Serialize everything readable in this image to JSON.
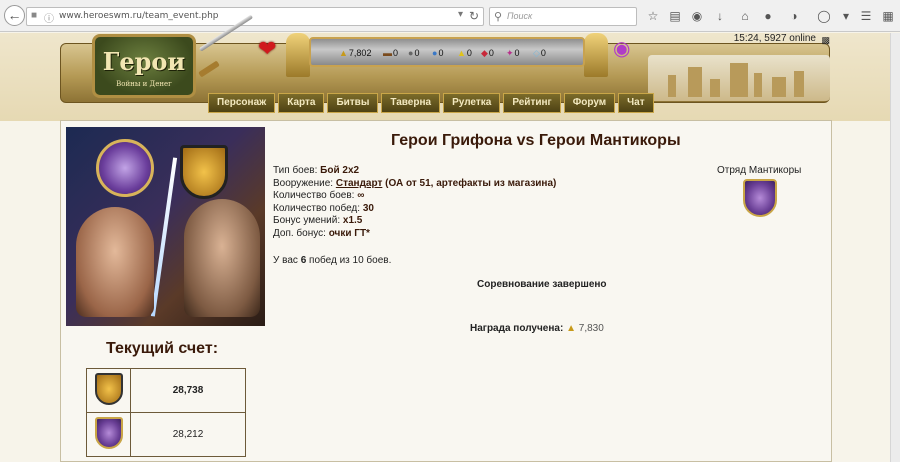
{
  "browser": {
    "url": "www.heroeswm.ru/team_event.php",
    "search_placeholder": "Поиск"
  },
  "header": {
    "logo_main": "Герои",
    "logo_sub": "Войны и Денег",
    "resources": [
      {
        "icon": "gold-icon",
        "value": "7,802"
      },
      {
        "icon": "wood-icon",
        "value": "0"
      },
      {
        "icon": "ore-icon",
        "value": "0"
      },
      {
        "icon": "mercury-icon",
        "value": "0"
      },
      {
        "icon": "sulfur-icon",
        "value": "0"
      },
      {
        "icon": "crystal-icon",
        "value": "0"
      },
      {
        "icon": "gems-icon",
        "value": "0"
      },
      {
        "icon": "diamond-icon",
        "value": "0"
      }
    ],
    "clock": "15:24, 5927 online",
    "menu": [
      "Персонаж",
      "Карта",
      "Битвы",
      "Таверна",
      "Рулетка",
      "Рейтинг",
      "Форум",
      "Чат"
    ]
  },
  "event": {
    "title": "Герои Грифона vs Герои Мантикоры",
    "battle_type_label": "Тип боев:",
    "battle_type": "Бой 2x2",
    "armament_label": "Вооружение:",
    "armament_link": "Стандарт",
    "armament_note": "(ОА от 51, артефакты из магазина)",
    "battles_count_label": "Количество боев:",
    "battles_count": "∞",
    "wins_count_label": "Количество побед:",
    "wins_count": "30",
    "skill_bonus_label": "Бонус умений:",
    "skill_bonus": "x1.5",
    "extra_bonus_label": "Доп. бонус:",
    "extra_bonus": "очки ГТ*",
    "squad_label": "Отряд Мантикоры",
    "wins_prefix": "У вас",
    "wins_value": "6",
    "wins_suffix": "побед из 10 боев.",
    "status": "Соревнование завершено",
    "reward_label": "Награда получена:",
    "reward_value": "7,830"
  },
  "score": {
    "title": "Текущий счет:",
    "rows": [
      {
        "team": "Грифон",
        "value": "28,738"
      },
      {
        "team": "Мантикора",
        "value": "28,212"
      }
    ]
  }
}
